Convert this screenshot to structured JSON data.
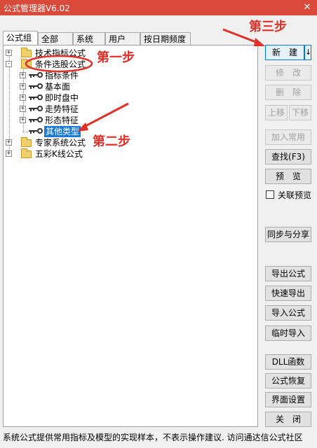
{
  "window": {
    "title": "公式管理器V6.02",
    "close_glyph": "✕"
  },
  "tabs": [
    {
      "label": "公式组",
      "active": true
    },
    {
      "label": "全部",
      "active": false
    },
    {
      "label": "系统",
      "active": false
    },
    {
      "label": "用户",
      "active": false
    },
    {
      "label": "按日期频度",
      "active": false
    }
  ],
  "tree": {
    "technical": {
      "label": "技术指标公式",
      "expander": "+"
    },
    "stock_select": {
      "label": "条件选股公式",
      "expander": "-"
    },
    "children": [
      {
        "label": "指标条件",
        "expander": "+"
      },
      {
        "label": "基本面",
        "expander": "+"
      },
      {
        "label": "即时盘中",
        "expander": "+"
      },
      {
        "label": "走势特征",
        "expander": "+"
      },
      {
        "label": "形态特征",
        "expander": "+"
      },
      {
        "label": "其他类型",
        "expander": ""
      }
    ],
    "expert": {
      "label": "专家系统公式",
      "expander": "+"
    },
    "color_kline": {
      "label": "五彩K线公式",
      "expander": "+"
    }
  },
  "buttons": {
    "new": "新　建",
    "new_dropdown": "↓",
    "edit": "修　改",
    "delete": "删　除",
    "move_up": "上移",
    "move_down": "下移",
    "add_common": "加入常用",
    "find": "查找(F3)",
    "preview": "预　览",
    "linked_preview": "关联预览",
    "sync_share": "同步与分享",
    "export": "导出公式",
    "quick_export": "快速导出",
    "import": "导入公式",
    "temp_import": "临时导入",
    "dll_func": "DLL函数",
    "restore": "公式恢复",
    "ui_settings": "界面设置",
    "close": "关　闭"
  },
  "status": {
    "text": "系统公式提供常用指标及模型的实现样本，不表示操作建议.  访问通达信公式社区"
  },
  "annotations": {
    "step1": "第一步",
    "step2": "第二步",
    "step3": "第三步",
    "color": "#e0302a"
  }
}
